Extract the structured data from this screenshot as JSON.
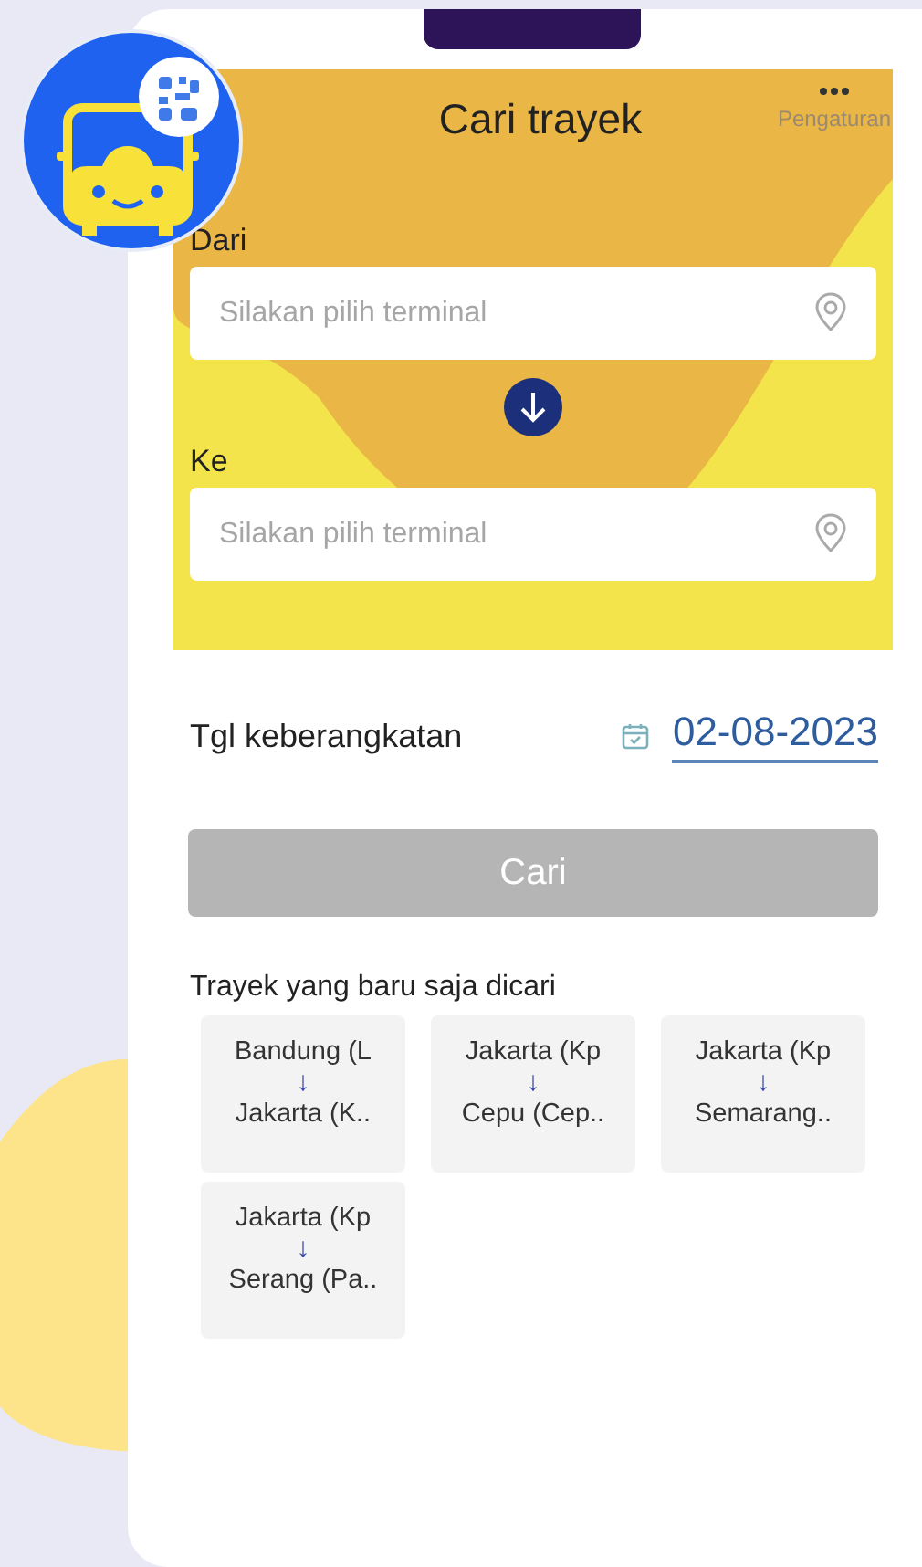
{
  "header": {
    "title": "Cari trayek",
    "menu_label": "Pengaturan"
  },
  "from": {
    "label": "Dari",
    "placeholder": "Silakan pilih terminal"
  },
  "to": {
    "label": "Ke",
    "placeholder": "Silakan pilih terminal"
  },
  "date": {
    "label": "Tgl keberangkatan",
    "value": "02-08-2023"
  },
  "search_button": {
    "label": "Cari",
    "disabled": true
  },
  "recent": {
    "title": "Trayek yang baru saja dicari",
    "routes": [
      {
        "from": "Bandung (L",
        "arrow": "↓",
        "to": "Jakarta (K.."
      },
      {
        "from": "Jakarta (Kp",
        "arrow": "↓",
        "to": "Cepu (Cep.."
      },
      {
        "from": "Jakarta (Kp",
        "arrow": "↓",
        "to": "Semarang.."
      },
      {
        "from": "Jakarta (Kp",
        "arrow": "↓",
        "to": "Serang (Pa.."
      }
    ]
  }
}
